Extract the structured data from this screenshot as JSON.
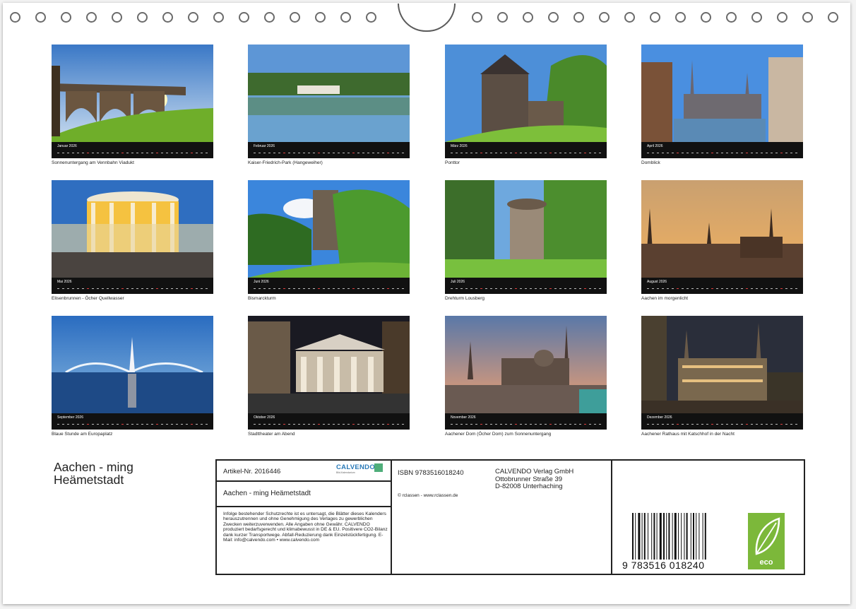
{
  "months": [
    {
      "name": "Januar 2026",
      "caption": "Sonnenuntergang am Vennbahn Viadukt",
      "scene": "viaduct"
    },
    {
      "name": "Februar 2026",
      "caption": "Kaiser-Friedrich-Park (Hangeweiher)",
      "scene": "lake"
    },
    {
      "name": "März 2026",
      "caption": "Ponttor",
      "scene": "gate"
    },
    {
      "name": "April 2026",
      "caption": "Domblick",
      "scene": "domblick"
    },
    {
      "name": "Mai 2026",
      "caption": "Elisenbrunnen - Öcher Quellwasser",
      "scene": "elisen"
    },
    {
      "name": "Juni 2026",
      "caption": "Bismarckturm",
      "scene": "tower"
    },
    {
      "name": "Juli 2026",
      "caption": "Drehturm Lousberg",
      "scene": "drehturm"
    },
    {
      "name": "August 2026",
      "caption": "Aachen im morgenlicht",
      "scene": "morning"
    },
    {
      "name": "September 2026",
      "caption": "Blaue Stunde am Europaplatz",
      "scene": "fountain"
    },
    {
      "name": "Oktober 2026",
      "caption": "Stadttheater am Abend",
      "scene": "theater"
    },
    {
      "name": "November 2026",
      "caption": "Aachener Dom (Öcher Dom) zum Sonnenuntergang",
      "scene": "dom"
    },
    {
      "name": "Dezember 2026",
      "caption": "Aachener Rathaus mit Katschhof in der Nacht",
      "scene": "rathaus"
    }
  ],
  "cover_title_line1": "Aachen - ming",
  "cover_title_line2": "Heämetstadt",
  "info": {
    "article": "Artikel-Nr. 2016446",
    "logo_text": "CALVENDO",
    "logo_sub": "Bild-Kalendarium",
    "subtitle": "Aachen - ming Heämetstadt",
    "legal": "Infolge bestehender Schutzrechte ist es untersagt, die Blätter dieses Kalenders herauszutrennen und ohne Genehmigung des Verlages zu gewerblichen Zwecken weiterzuverwenden. Alle Angaben ohne Gewähr. CALVENDO produziert bedarfsgerecht und klimabewusst in DE & EU. Positivere CO2-Bilanz dank kurzer Transportwege. Abfall-Reduzierung dank Einzelstückfertigung. E-Mail: info@calvendo.com • www.calvendo.com",
    "isbn": "ISBN 9783516018240",
    "publisher_line1": "CALVENDO Verlag GmbH",
    "publisher_line2": "Ottobrunner Straße 39",
    "publisher_line3": "D-82008 Unterhaching",
    "photographer": "© rclassen - www.rclassen.de",
    "barcode_digits": "9  783516  018240",
    "eco_label": "eco"
  },
  "colors": {
    "calendar_bar": "#111111",
    "eco_green": "#7cb83a",
    "calvendo_blue": "#2a7ab8"
  }
}
